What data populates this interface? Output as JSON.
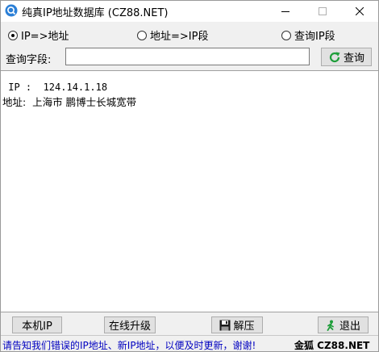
{
  "window": {
    "title": "纯真IP地址数据库  (CZ88.NET)",
    "minimize_symbol": "—",
    "close_symbol": "✕"
  },
  "modes": {
    "ip_to_address": "IP=>地址",
    "address_to_ip": "地址=>IP段",
    "query_ip_range": "查询IP段",
    "selected": "ip_to_address"
  },
  "query": {
    "label": "查询字段:",
    "value": "",
    "button_label": "查询"
  },
  "result": {
    "ip_label": " IP :",
    "ip_value": "124.14.1.18",
    "address_label": "地址:",
    "address_value": "上海市 鹏博士长城宽带"
  },
  "buttons": {
    "local_ip": "本机IP",
    "online_upgrade": "在线升级",
    "decompress": "解压",
    "exit": "退出"
  },
  "status": {
    "message": "请告知我们错误的IP地址、新IP地址，以便及时更新，谢谢!",
    "brand": "金狐  CZ88.NET"
  },
  "colors": {
    "status_text": "#0000c0",
    "refresh_icon": "#1e9e3a",
    "app_icon": "#2b7fd6"
  }
}
